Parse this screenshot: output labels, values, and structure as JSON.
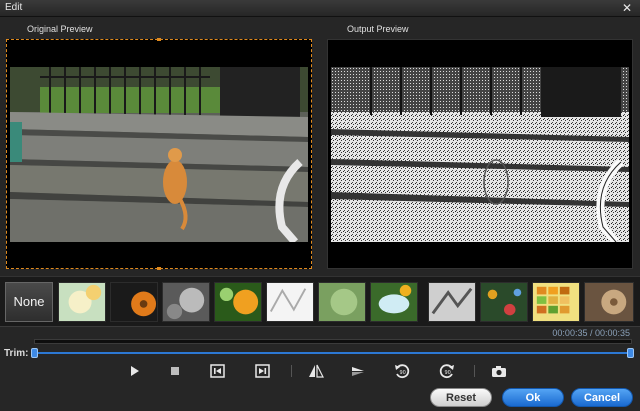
{
  "window": {
    "title": "Edit",
    "close_icon": "close-icon"
  },
  "preview": {
    "original_label": "Original Preview",
    "output_label": "Output Preview",
    "accent_color": "#e08a1e"
  },
  "effects": {
    "none_label": "None",
    "thumbnails": [
      "glow",
      "dark",
      "grayscale",
      "warm",
      "bright",
      "sketch",
      "blur",
      "contrast",
      "butterfly",
      "emboss",
      "mosaic",
      "tiles",
      "sepia"
    ]
  },
  "timeline": {
    "timecode": "00:00:35 / 00:00:35",
    "progress": 1.0
  },
  "trim": {
    "label": "Trim:",
    "start": 0.0,
    "end": 1.0,
    "color": "#2c78d4"
  },
  "toolbar": {
    "tools": [
      "play-icon",
      "stop-icon",
      "previous-frame-icon",
      "next-frame-icon",
      "flip-horizontal-icon",
      "flip-vertical-icon",
      "rotate-left-icon",
      "rotate-right-icon",
      "snapshot-icon"
    ]
  },
  "buttons": {
    "reset": "Reset",
    "ok": "Ok",
    "cancel": "Cancel"
  }
}
